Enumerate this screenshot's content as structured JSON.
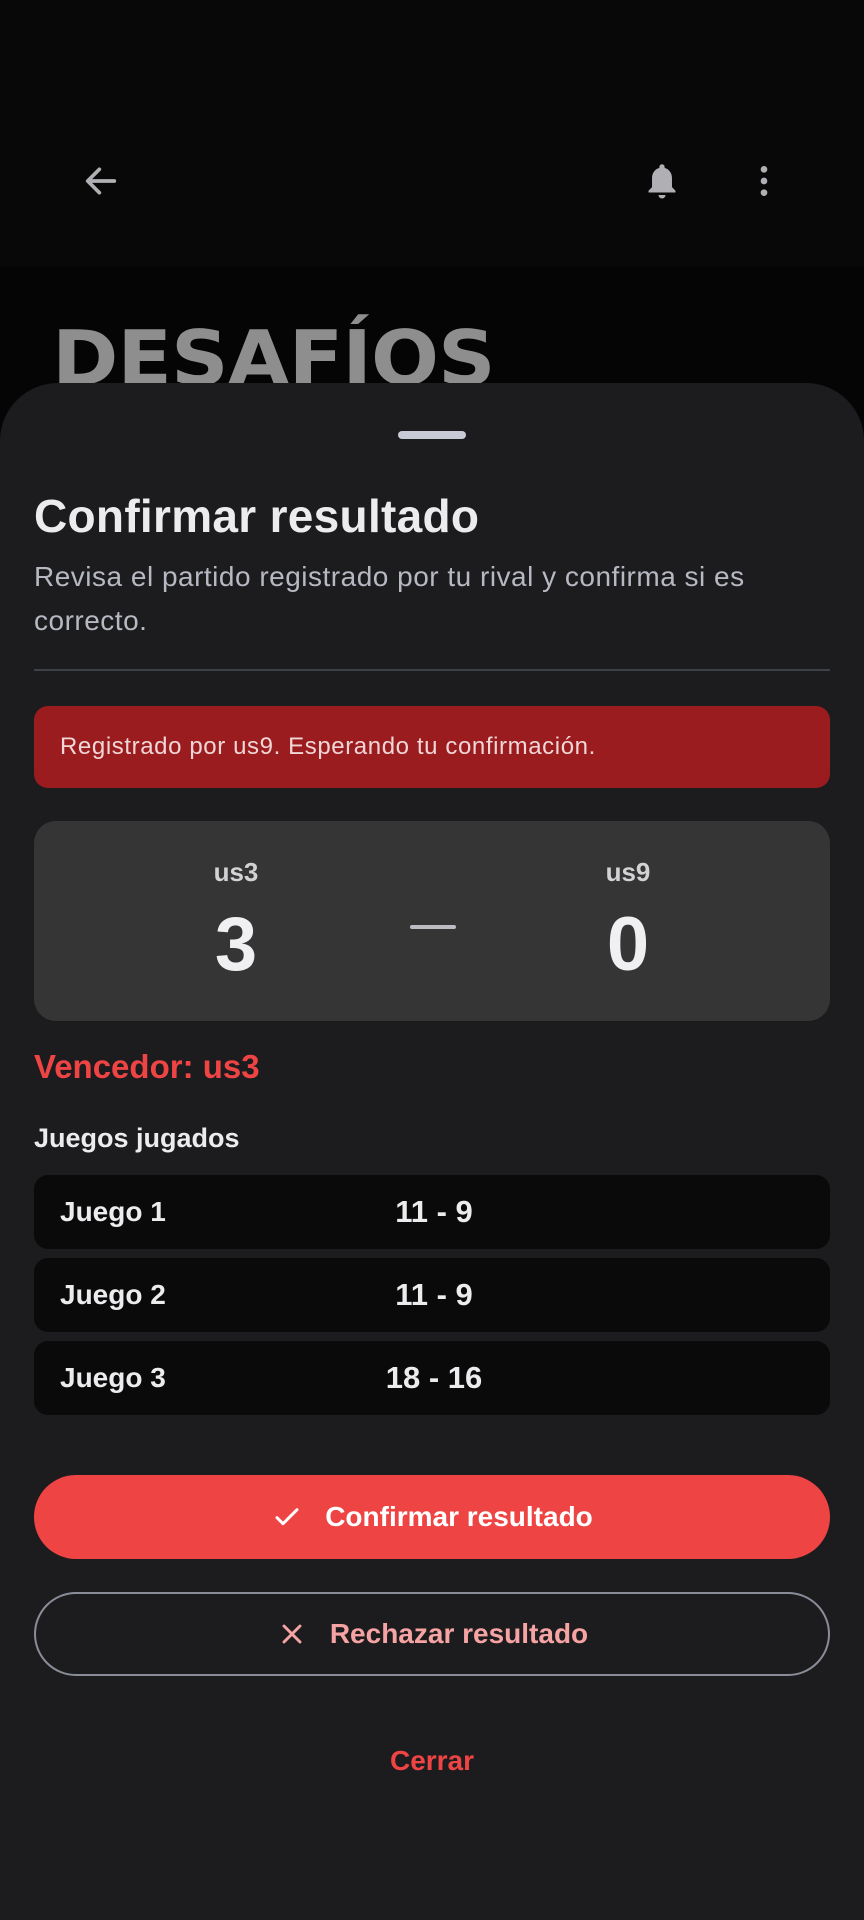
{
  "appbar": {
    "back_icon": "arrow-left-icon",
    "bell_icon": "bell-icon",
    "more_icon": "more-vertical-icon"
  },
  "background": {
    "title": "DESAFÍOS"
  },
  "sheet": {
    "title": "Confirmar resultado",
    "description": "Revisa el partido registrado por tu rival y confirma si es correcto.",
    "alert": "Registrado por us9. Esperando tu confirmación.",
    "match": {
      "player1": {
        "name": "us3",
        "score": "3"
      },
      "player2": {
        "name": "us9",
        "score": "0"
      }
    },
    "winner": "Vencedor: us3",
    "games_label": "Juegos jugados",
    "games": [
      {
        "name": "Juego 1",
        "score": "11 - 9"
      },
      {
        "name": "Juego 2",
        "score": "11 - 9"
      },
      {
        "name": "Juego 3",
        "score": "18 - 16"
      }
    ],
    "confirm_label": "Confirmar resultado",
    "reject_label": "Rechazar resultado",
    "close_label": "Cerrar"
  },
  "colors": {
    "accent": "#ef4444",
    "alert_bg": "#9b1c1f",
    "sheet_bg": "#1c1c1e",
    "card_bg": "#353535"
  }
}
